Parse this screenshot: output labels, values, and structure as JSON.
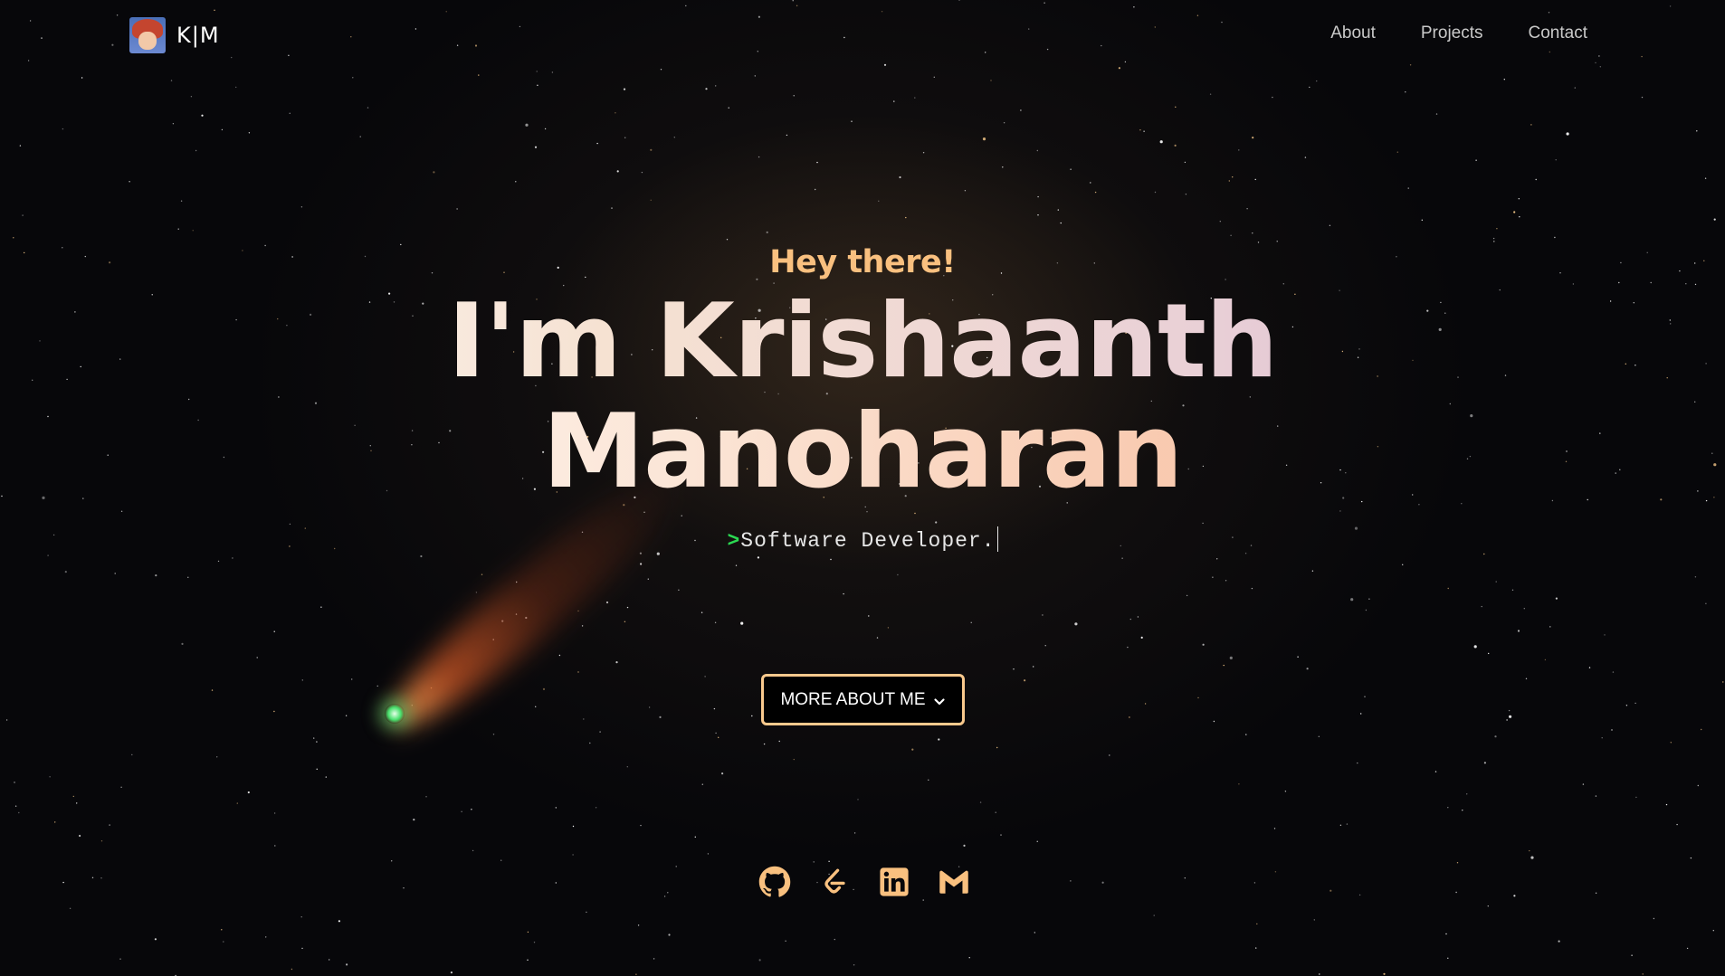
{
  "nav": {
    "brand": "K|M",
    "links": [
      {
        "label": "About"
      },
      {
        "label": "Projects"
      },
      {
        "label": "Contact"
      }
    ]
  },
  "hero": {
    "greeting": "Hey there!",
    "name_line1": "I'm Krishaanth",
    "name_line2": "Manoharan",
    "prompt": ">",
    "role": "Software Developer."
  },
  "cta": {
    "label": "MORE ABOUT ME"
  },
  "socials": [
    {
      "icon": "github-icon"
    },
    {
      "icon": "leetcode-icon"
    },
    {
      "icon": "linkedin-icon"
    },
    {
      "icon": "gmail-icon"
    }
  ],
  "colors": {
    "accent": "#f9c07f",
    "prompt": "#2bd952",
    "background": "#07070a"
  }
}
